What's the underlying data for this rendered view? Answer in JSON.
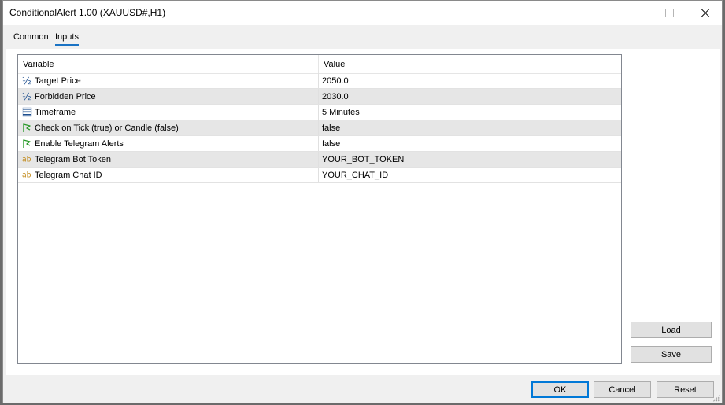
{
  "window": {
    "title": "ConditionalAlert 1.00 (XAUUSD#,H1)"
  },
  "tabs": [
    {
      "label": "Common",
      "active": false
    },
    {
      "label": "Inputs",
      "active": true
    }
  ],
  "grid": {
    "headers": {
      "variable": "Variable",
      "value": "Value"
    },
    "rows": [
      {
        "icon": "fraction-icon",
        "glyph": "½",
        "icon_color": "#1e4f8f",
        "variable": "Target Price",
        "value": "2050.0"
      },
      {
        "icon": "fraction-icon",
        "glyph": "½",
        "icon_color": "#1e4f8f",
        "variable": "Forbidden Price",
        "value": "2030.0"
      },
      {
        "icon": "list-enum-icon",
        "glyph": "",
        "icon_color": "#1e4f8f",
        "variable": "Timeframe",
        "value": "5 Minutes"
      },
      {
        "icon": "boolean-flag-icon",
        "glyph": "",
        "icon_color": "#2a9a2a",
        "variable": "Check on Tick (true) or Candle (false)",
        "value": "false"
      },
      {
        "icon": "boolean-flag-icon",
        "glyph": "",
        "icon_color": "#2a9a2a",
        "variable": "Enable Telegram Alerts",
        "value": "false"
      },
      {
        "icon": "string-ab-icon",
        "glyph": "ab",
        "icon_color": "#c28a1a",
        "variable": "Telegram Bot Token",
        "value": "YOUR_BOT_TOKEN"
      },
      {
        "icon": "string-ab-icon",
        "glyph": "ab",
        "icon_color": "#c28a1a",
        "variable": "Telegram Chat ID",
        "value": "YOUR_CHAT_ID"
      }
    ]
  },
  "side_buttons": {
    "load": "Load",
    "save": "Save"
  },
  "footer_buttons": {
    "ok": "OK",
    "cancel": "Cancel",
    "reset": "Reset"
  }
}
